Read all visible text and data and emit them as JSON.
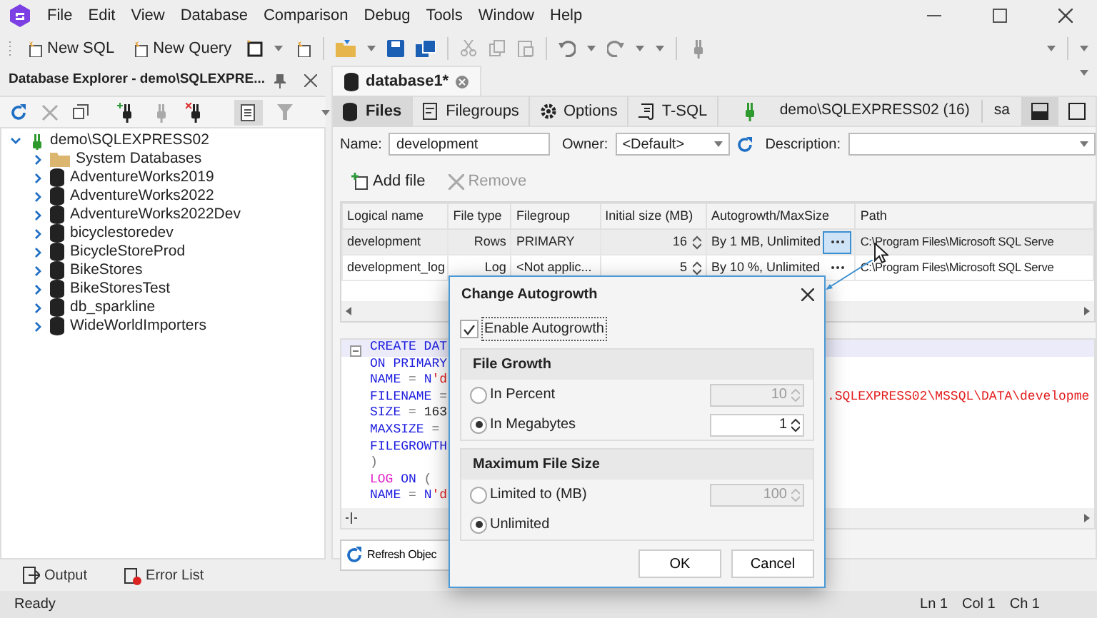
{
  "menu": [
    "File",
    "Edit",
    "View",
    "Database",
    "Comparison",
    "Debug",
    "Tools",
    "Window",
    "Help"
  ],
  "toolbar": {
    "buttons": [
      {
        "label": "New SQL"
      },
      {
        "label": "New Query"
      }
    ]
  },
  "explorer": {
    "title": "Database Explorer - demo\\SQLEXPRE...",
    "tree": [
      {
        "label": "demo\\SQLEXPRESS02",
        "kind": "server",
        "expanded": true,
        "children": [
          {
            "label": "System Databases",
            "kind": "folder",
            "expanded": false
          },
          {
            "label": "AdventureWorks2019",
            "kind": "database",
            "expanded": false
          },
          {
            "label": "AdventureWorks2022",
            "kind": "database",
            "expanded": false
          },
          {
            "label": "AdventureWorks2022Dev",
            "kind": "database",
            "expanded": false
          },
          {
            "label": "bicyclestoredev",
            "kind": "database",
            "expanded": false
          },
          {
            "label": "BicycleStoreProd",
            "kind": "database",
            "expanded": false
          },
          {
            "label": "BikeStores",
            "kind": "database",
            "expanded": false
          },
          {
            "label": "BikeStoresTest",
            "kind": "database",
            "expanded": false
          },
          {
            "label": "db_sparkline",
            "kind": "database",
            "expanded": false
          },
          {
            "label": "WideWorldImporters",
            "kind": "database",
            "expanded": false
          }
        ]
      }
    ]
  },
  "document": {
    "tab": "database1*",
    "subtabs": [
      {
        "label": "Files",
        "kind": "database",
        "selected": true
      },
      {
        "label": "Filegroups",
        "kind": "filegroups",
        "selected": false
      },
      {
        "label": "Options",
        "kind": "gear",
        "selected": false
      },
      {
        "label": "T-SQL",
        "kind": "script",
        "selected": false
      }
    ],
    "connection": "demo\\SQLEXPRESS02 (16)",
    "user": "sa",
    "form": {
      "name_label": "Name:",
      "name_value": "development",
      "owner_label": "Owner:",
      "owner_value": "<Default>",
      "description_label": "Description:"
    },
    "file_actions": [
      {
        "label": "Add file",
        "kind": "add",
        "disabled": false
      },
      {
        "label": "Remove",
        "kind": "remove",
        "disabled": true
      }
    ],
    "table": {
      "columns": [
        "Logical name",
        "File type",
        "Filegroup",
        "Initial size (MB)",
        "Autogrowth/MaxSize",
        "Path"
      ],
      "rows": [
        {
          "selected": true,
          "cells": [
            "development",
            "Rows",
            "PRIMARY",
            "16",
            "By 1 MB, Unlimited",
            "C:\\Program Files\\Microsoft SQL Serve"
          ]
        },
        {
          "selected": false,
          "cells": [
            "development_log",
            "Log",
            "<Not applic...",
            "5",
            "By 10 %, Unlimited",
            "C:\\Program Files\\Microsoft SQL Serve"
          ]
        }
      ]
    },
    "sql": [
      {
        "highlighted": true,
        "left": [
          {
            "t": "CREATE DAT",
            "kind": "keyword"
          }
        ]
      },
      {
        "highlighted": false,
        "left": [
          {
            "t": "ON PRIMARY",
            "kind": "keyword"
          }
        ]
      },
      {
        "highlighted": false,
        "left": [
          {
            "t": "NAME",
            "kind": "keyword"
          },
          {
            "t": " = ",
            "kind": "operator"
          },
          {
            "t": "N",
            "kind": "keyword"
          },
          {
            "t": "'d",
            "kind": "string"
          }
        ]
      },
      {
        "highlighted": false,
        "left": [
          {
            "t": "FILENAME",
            "kind": "keyword"
          },
          {
            "t": " =",
            "kind": "operator"
          }
        ],
        "right": [
          {
            "t": ".SQLEXPRESS02\\MSSQL\\DATA\\developme",
            "kind": "string"
          }
        ]
      },
      {
        "highlighted": false,
        "left": [
          {
            "t": "SIZE",
            "kind": "keyword"
          },
          {
            "t": " = ",
            "kind": "operator"
          },
          {
            "t": "163",
            "kind": "plain"
          }
        ]
      },
      {
        "highlighted": false,
        "left": [
          {
            "t": "MAXSIZE",
            "kind": "keyword"
          },
          {
            "t": " =",
            "kind": "operator"
          }
        ]
      },
      {
        "highlighted": false,
        "left": [
          {
            "t": "FILEGROWTH",
            "kind": "keyword"
          }
        ]
      },
      {
        "highlighted": false,
        "left": [
          {
            "t": ")",
            "kind": "operator"
          }
        ]
      },
      {
        "highlighted": false,
        "left": [
          {
            "t": "LOG",
            "kind": "special"
          },
          {
            "t": " ON",
            "kind": "keyword"
          },
          {
            "t": " (",
            "kind": "operator"
          }
        ]
      },
      {
        "highlighted": false,
        "left": [
          {
            "t": "NAME",
            "kind": "keyword"
          },
          {
            "t": " = ",
            "kind": "operator"
          },
          {
            "t": "N",
            "kind": "keyword"
          },
          {
            "t": "'d",
            "kind": "string"
          }
        ]
      }
    ],
    "refresh_button": "Refresh Objec"
  },
  "bottom_tabs": [
    {
      "label": "Output",
      "kind": "output"
    },
    {
      "label": "Error List",
      "kind": "errors"
    }
  ],
  "status_bar": {
    "text": "Ready",
    "ln": "Ln 1",
    "col": "Col 1",
    "ch": "Ch 1"
  },
  "dialog": {
    "title": "Change Autogrowth",
    "enable": {
      "label": "Enable Autogrowth",
      "checked": true
    },
    "groups": [
      {
        "title": "File Growth",
        "options": [
          {
            "label": "In Percent",
            "selected": false,
            "value": "10"
          },
          {
            "label": "In Megabytes",
            "selected": true,
            "value": "1"
          }
        ]
      },
      {
        "title": "Maximum File Size",
        "options": [
          {
            "label": "Limited to (MB)",
            "selected": false,
            "value": "100"
          },
          {
            "label": "Unlimited",
            "selected": true
          }
        ]
      }
    ],
    "buttons": [
      "OK",
      "Cancel"
    ]
  }
}
